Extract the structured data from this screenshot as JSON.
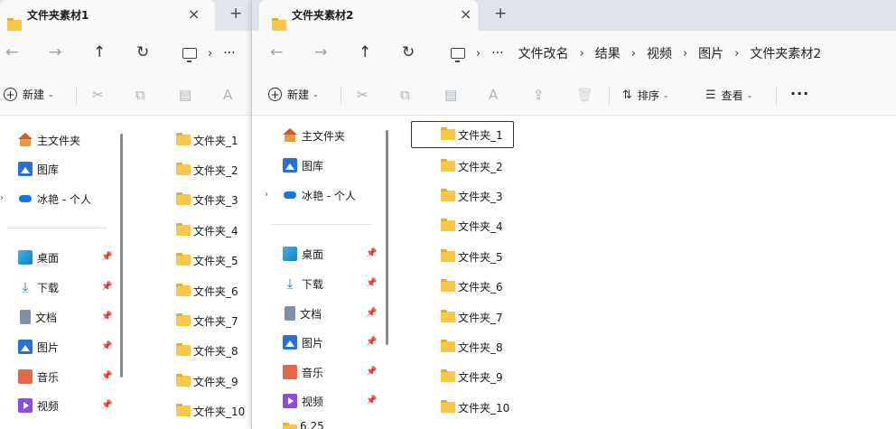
{
  "window1": {
    "tab_title": "文件夹素材1",
    "tab_close": "×",
    "new_tab": "+",
    "nav": {
      "back": "←",
      "forward": "→",
      "up": "↑",
      "refresh": "↻"
    },
    "address": {
      "sep": "›",
      "overflow": "···"
    },
    "toolbar": {
      "new_label": "新建",
      "plus": "+",
      "chev": "⌄"
    },
    "sidebar": {
      "home": "主文件夹",
      "gallery": "图库",
      "cloud": "冰艳 - 个人",
      "desktop": "桌面",
      "downloads": "下载",
      "documents": "文档",
      "pictures": "图片",
      "music": "音乐",
      "videos": "视频"
    },
    "folders": [
      "文件夹_1",
      "文件夹_2",
      "文件夹_3",
      "文件夹_4",
      "文件夹_5",
      "文件夹_6",
      "文件夹_7",
      "文件夹_8",
      "文件夹_9",
      "文件夹_10"
    ]
  },
  "window2": {
    "tab_title": "文件夹素材2",
    "tab_close": "×",
    "new_tab": "+",
    "nav": {
      "back": "←",
      "forward": "→",
      "up": "↑",
      "refresh": "↻"
    },
    "address": {
      "sep": "›",
      "overflow": "···",
      "crumbs": [
        "文件改名",
        "结果",
        "视频",
        "图片",
        "文件夹素材2"
      ]
    },
    "toolbar": {
      "new_label": "新建",
      "plus": "+",
      "chev": "⌄",
      "sort_label": "排序",
      "sort_icon": "⇅",
      "view_label": "查看",
      "view_icon": "☰",
      "more": "···"
    },
    "sidebar": {
      "home": "主文件夹",
      "gallery": "图库",
      "cloud": "冰艳 - 个人",
      "desktop": "桌面",
      "downloads": "下载",
      "documents": "文档",
      "pictures": "图片",
      "music": "音乐",
      "videos": "视频",
      "partial": "6.25"
    },
    "folders": [
      "文件夹_1",
      "文件夹_2",
      "文件夹_3",
      "文件夹_4",
      "文件夹_5",
      "文件夹_6",
      "文件夹_7",
      "文件夹_8",
      "文件夹_9",
      "文件夹_10"
    ]
  },
  "icons": {
    "cut": "✂",
    "copy": "⧉",
    "paste": "▤",
    "rename": "A",
    "share": "⇪",
    "delete": "🗑",
    "pin": "📌",
    "expand": "›",
    "download_arrow": "⤓"
  }
}
